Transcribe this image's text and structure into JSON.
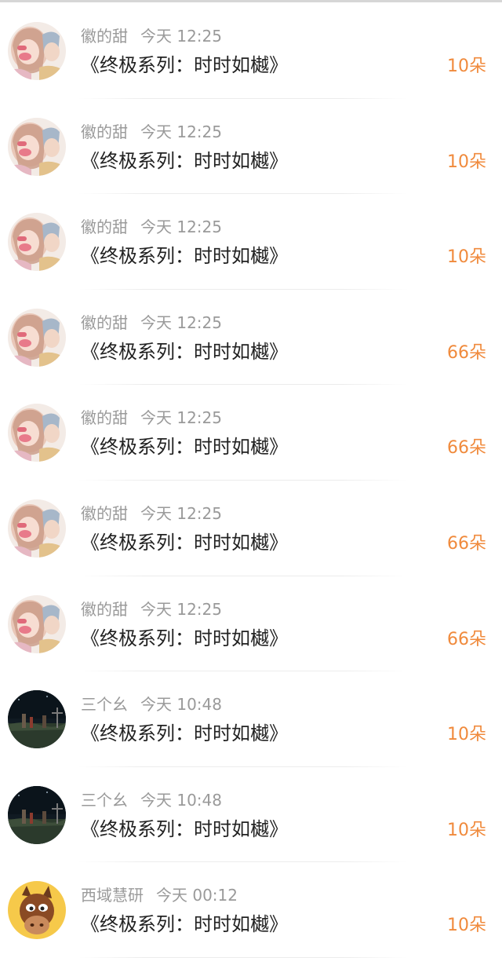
{
  "gifts": [
    {
      "user": "徽的甜",
      "time": "今天 12:25",
      "title": "《终极系列：时时如樾》",
      "amount": "10朵",
      "avatar": "anime-girl-avatar"
    },
    {
      "user": "徽的甜",
      "time": "今天 12:25",
      "title": "《终极系列：时时如樾》",
      "amount": "10朵",
      "avatar": "anime-girl-avatar"
    },
    {
      "user": "徽的甜",
      "time": "今天 12:25",
      "title": "《终极系列：时时如樾》",
      "amount": "10朵",
      "avatar": "anime-girl-avatar"
    },
    {
      "user": "徽的甜",
      "time": "今天 12:25",
      "title": "《终极系列：时时如樾》",
      "amount": "66朵",
      "avatar": "anime-girl-avatar"
    },
    {
      "user": "徽的甜",
      "time": "今天 12:25",
      "title": "《终极系列：时时如樾》",
      "amount": "66朵",
      "avatar": "anime-girl-avatar"
    },
    {
      "user": "徽的甜",
      "time": "今天 12:25",
      "title": "《终极系列：时时如樾》",
      "amount": "66朵",
      "avatar": "anime-girl-avatar"
    },
    {
      "user": "徽的甜",
      "time": "今天 12:25",
      "title": "《终极系列：时时如樾》",
      "amount": "66朵",
      "avatar": "anime-girl-avatar"
    },
    {
      "user": "三个幺",
      "time": "今天 10:48",
      "title": "《终极系列：时时如樾》",
      "amount": "10朵",
      "avatar": "night-scene-avatar"
    },
    {
      "user": "三个幺",
      "time": "今天 10:48",
      "title": "《终极系列：时时如樾》",
      "amount": "10朵",
      "avatar": "night-scene-avatar"
    },
    {
      "user": "西域慧研",
      "time": "今天 00:12",
      "title": "《终极系列：时时如樾》",
      "amount": "10朵",
      "avatar": "cartoon-horse-avatar"
    }
  ],
  "colors": {
    "amount": "#f08a3c",
    "meta": "#9a9a9a",
    "title": "#222222"
  }
}
